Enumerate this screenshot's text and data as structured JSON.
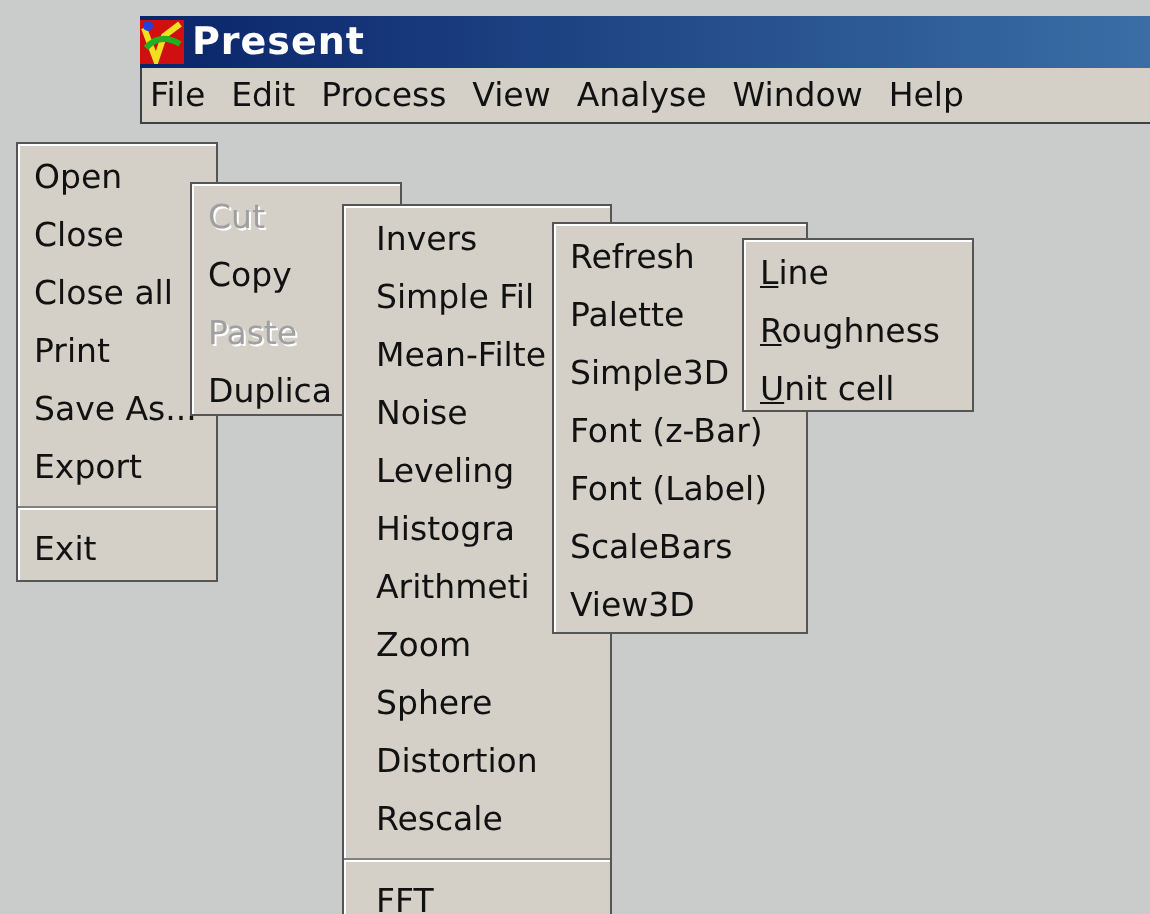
{
  "window": {
    "title": "Present"
  },
  "menubar": [
    {
      "label": "File"
    },
    {
      "label": "Edit"
    },
    {
      "label": "Process"
    },
    {
      "label": "View"
    },
    {
      "label": "Analyse"
    },
    {
      "label": "Window"
    },
    {
      "label": "Help"
    }
  ],
  "menus": [
    {
      "items": [
        {
          "kind": "item",
          "label": "Open",
          "disabled": false
        },
        {
          "kind": "item",
          "label": "Close",
          "disabled": false
        },
        {
          "kind": "item",
          "label": "Close all",
          "disabled": false
        },
        {
          "kind": "item",
          "label": "Print",
          "disabled": false
        },
        {
          "kind": "item",
          "label": "Save As...",
          "disabled": false
        },
        {
          "kind": "item",
          "label": "Export",
          "disabled": false
        },
        {
          "kind": "separator"
        },
        {
          "kind": "item",
          "label": "Exit",
          "disabled": false
        }
      ]
    },
    {
      "items": [
        {
          "kind": "item",
          "label": "Cut",
          "disabled": true
        },
        {
          "kind": "item",
          "label": "Copy",
          "disabled": false
        },
        {
          "kind": "item",
          "label": "Paste",
          "disabled": true
        },
        {
          "kind": "item",
          "label": "Duplica",
          "disabled": false
        }
      ]
    },
    {
      "items": [
        {
          "kind": "item",
          "label": "Invers",
          "disabled": false
        },
        {
          "kind": "item",
          "label": "Simple Fil",
          "disabled": false
        },
        {
          "kind": "item",
          "label": "Mean-Filte",
          "disabled": false
        },
        {
          "kind": "item",
          "label": "Noise",
          "disabled": false
        },
        {
          "kind": "item",
          "label": "Leveling",
          "disabled": false
        },
        {
          "kind": "item",
          "label": "Histogra",
          "disabled": false
        },
        {
          "kind": "item",
          "label": "Arithmeti",
          "disabled": false
        },
        {
          "kind": "item",
          "label": "Zoom",
          "disabled": false
        },
        {
          "kind": "item",
          "label": "Sphere",
          "disabled": false
        },
        {
          "kind": "item",
          "label": "Distortion",
          "disabled": false
        },
        {
          "kind": "item",
          "label": "Rescale",
          "disabled": false
        },
        {
          "kind": "separator"
        },
        {
          "kind": "item",
          "label": "FFT",
          "disabled": false
        }
      ]
    },
    {
      "items": [
        {
          "kind": "item",
          "label": "Refresh",
          "disabled": false
        },
        {
          "kind": "item",
          "label": "Palette",
          "disabled": false
        },
        {
          "kind": "item",
          "label": "Simple3D",
          "disabled": false
        },
        {
          "kind": "item",
          "label": "Font (z-Bar)",
          "disabled": false
        },
        {
          "kind": "item",
          "label": "Font (Label)",
          "disabled": false
        },
        {
          "kind": "item",
          "label": "ScaleBars",
          "disabled": false
        },
        {
          "kind": "item",
          "label": "View3D",
          "disabled": false
        }
      ]
    },
    {
      "items": [
        {
          "kind": "item",
          "label": "Line",
          "disabled": false,
          "mnemonic": true
        },
        {
          "kind": "item",
          "label": "Roughness",
          "disabled": false,
          "mnemonic": true
        },
        {
          "kind": "item",
          "label": "Unit cell",
          "disabled": false,
          "mnemonic": true
        }
      ]
    }
  ]
}
